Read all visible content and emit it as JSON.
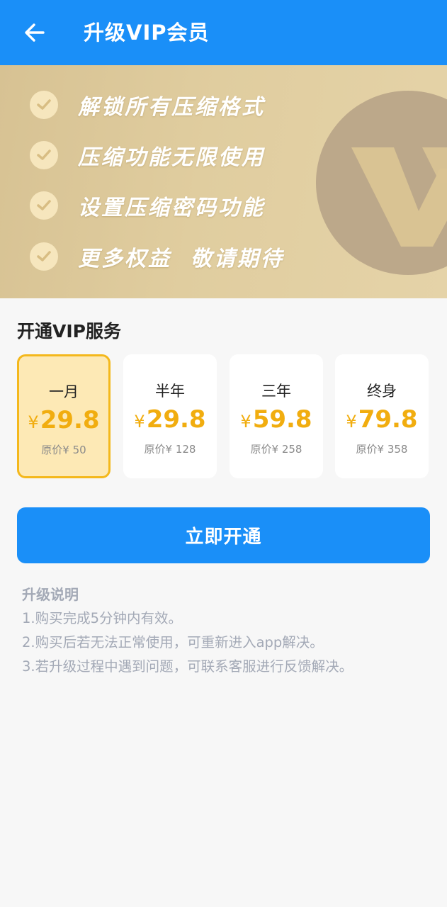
{
  "header": {
    "title": "升级VIP会员",
    "back_icon": "arrow-left-icon"
  },
  "banner": {
    "benefits": [
      "解锁所有压缩格式",
      "压缩功能无限使用",
      "设置压缩密码功能",
      "更多权益  敬请期待"
    ],
    "logo_icon": "vip-v-logo-icon"
  },
  "plans_section": {
    "title": "开通VIP服务",
    "currency": "¥",
    "plans": [
      {
        "name": "一月",
        "price": "29.8",
        "original": "原价¥ 50",
        "selected": true
      },
      {
        "name": "半年",
        "price": "29.8",
        "original": "原价¥ 128",
        "selected": false
      },
      {
        "name": "三年",
        "price": "59.8",
        "original": "原价¥ 258",
        "selected": false
      },
      {
        "name": "终身",
        "price": "79.8",
        "original": "原价¥ 358",
        "selected": false
      }
    ]
  },
  "action": {
    "open_label": "立即开通"
  },
  "notes": {
    "title": "升级说明",
    "lines": [
      "1.购买完成5分钟内有效。",
      "2.购买后若无法正常使用，可重新进入app解决。",
      "3.若升级过程中遇到问题，可联系客服进行反馈解决。"
    ]
  },
  "colors": {
    "primary": "#1a8ff8",
    "banner_gold": "#dcc79a",
    "price_gold": "#f1ad0f",
    "selected_bg": "#fde9b5",
    "selected_border": "#f4b81c",
    "notes_text": "#a3a9b6"
  }
}
